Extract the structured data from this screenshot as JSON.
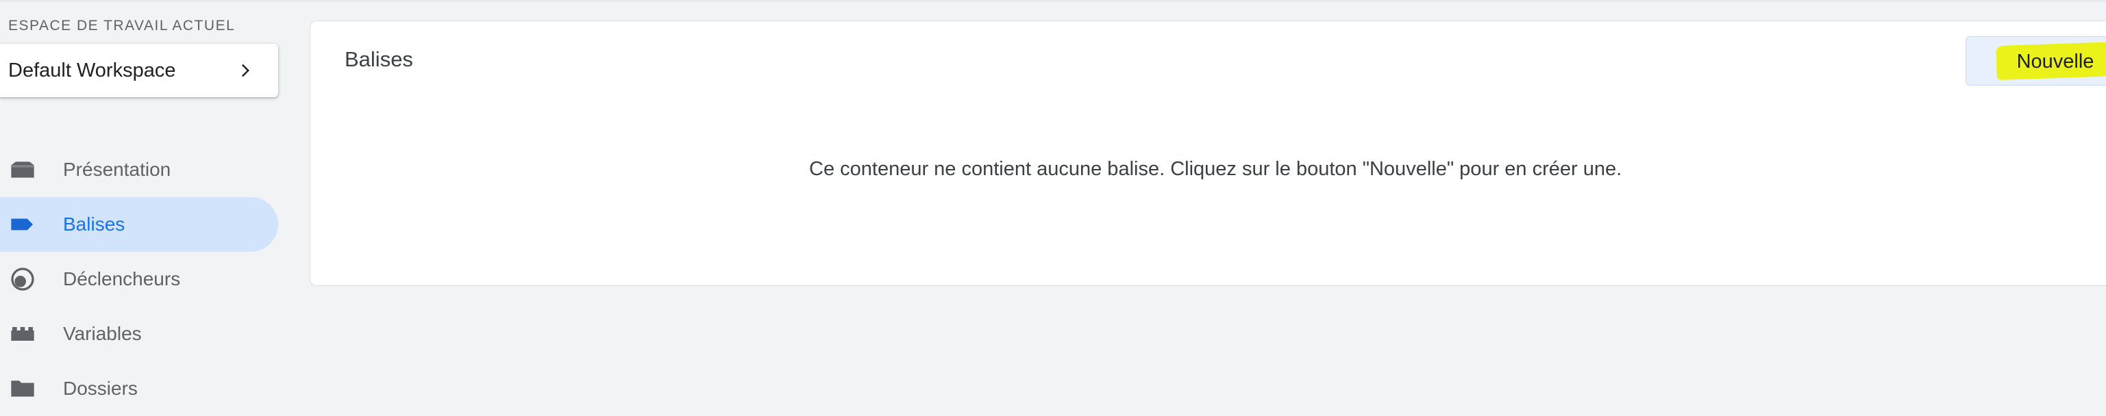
{
  "sidebar": {
    "workspace_label": "ESPACE DE TRAVAIL ACTUEL",
    "workspace_name": "Default Workspace",
    "items": [
      {
        "label": "Présentation",
        "icon": "overview-icon",
        "active": false
      },
      {
        "label": "Balises",
        "icon": "tag-icon",
        "active": true
      },
      {
        "label": "Déclencheurs",
        "icon": "trigger-icon",
        "active": false
      },
      {
        "label": "Variables",
        "icon": "variables-icon",
        "active": false
      },
      {
        "label": "Dossiers",
        "icon": "folder-icon",
        "active": false
      }
    ]
  },
  "main": {
    "title": "Balises",
    "new_button_label": "Nouvelle",
    "empty_message": "Ce conteneur ne contient aucune balise. Cliquez sur le bouton \"Nouvelle\" pour en créer une."
  },
  "colors": {
    "active_bg": "#d2e3fc",
    "active_text": "#1a73e8",
    "highlight": "#eaf21a",
    "page_bg": "#f1f3f4"
  }
}
